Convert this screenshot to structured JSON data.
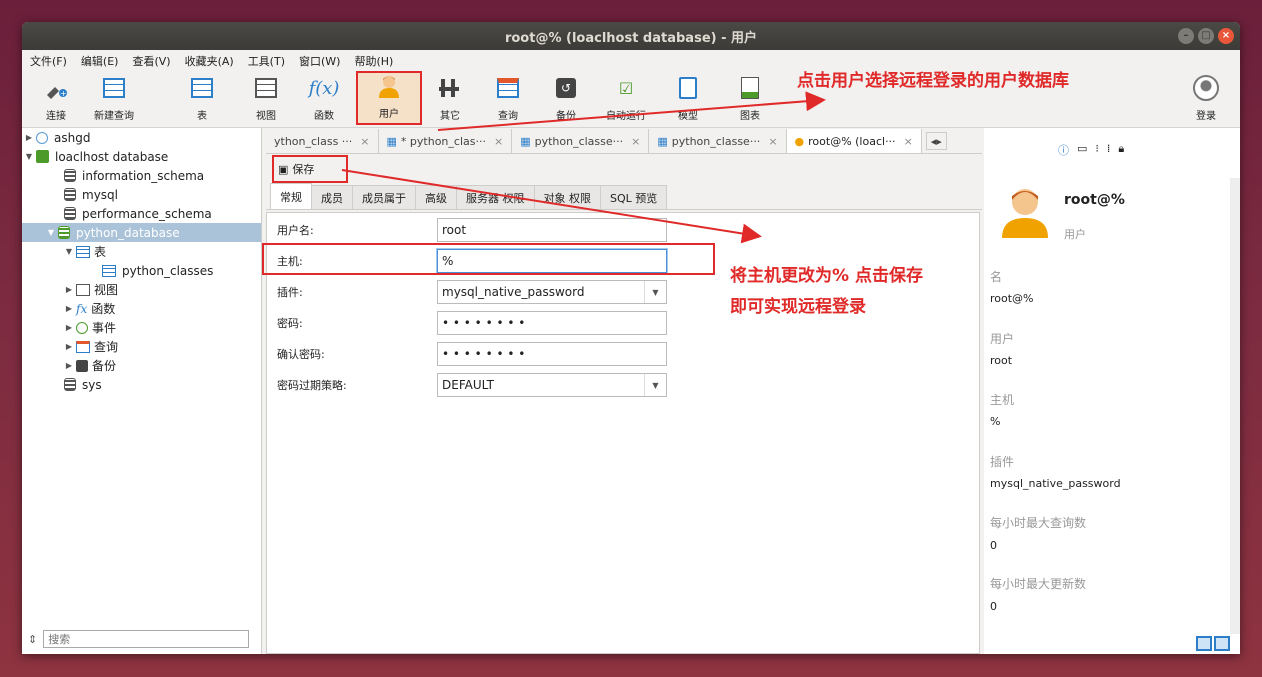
{
  "window": {
    "title": "root@% (loaclhost database) - 用户"
  },
  "menu": [
    "文件(F)",
    "编辑(E)",
    "查看(V)",
    "收藏夹(A)",
    "工具(T)",
    "窗口(W)",
    "帮助(H)"
  ],
  "toolbar": {
    "connect": "连接",
    "new_query": "新建查询",
    "table": "表",
    "view": "视图",
    "function": "函数",
    "user": "用户",
    "other": "其它",
    "query": "查询",
    "backup": "备份",
    "auto_run": "自动运行",
    "model": "模型",
    "chart": "图表",
    "login": "登录"
  },
  "tree": {
    "items": [
      {
        "label": "ashgd"
      },
      {
        "label": "loaclhost database"
      },
      {
        "label": "information_schema"
      },
      {
        "label": "mysql"
      },
      {
        "label": "performance_schema"
      },
      {
        "label": "python_database"
      },
      {
        "label": "表"
      },
      {
        "label": "python_classes"
      },
      {
        "label": "视图"
      },
      {
        "label": "函数"
      },
      {
        "label": "事件"
      },
      {
        "label": "查询"
      },
      {
        "label": "备份"
      },
      {
        "label": "sys"
      }
    ],
    "search_placeholder": "搜索"
  },
  "tabs": [
    {
      "label": "ython_class ···"
    },
    {
      "label": "* python_clas···"
    },
    {
      "label": "python_classe···"
    },
    {
      "label": "python_classe···"
    },
    {
      "label": "root@% (loacl···"
    }
  ],
  "save_label": "保存",
  "subtabs": [
    "常规",
    "成员",
    "成员属于",
    "高级",
    "服务器 权限",
    "对象 权限",
    "SQL 预览"
  ],
  "form": {
    "username_label": "用户名:",
    "username_value": "root",
    "host_label": "主机:",
    "host_value": "%",
    "plugin_label": "插件:",
    "plugin_value": "mysql_native_password",
    "password_label": "密码:",
    "password_value": "• • • • • • • •",
    "confirm_label": "确认密码:",
    "confirm_value": "• • • • • • • •",
    "expire_label": "密码过期策略:",
    "expire_value": "DEFAULT"
  },
  "info_panel": {
    "name_title": "root@%",
    "type": "用户",
    "fields": [
      {
        "label": "名",
        "value": "root@%"
      },
      {
        "label": "用户",
        "value": "root"
      },
      {
        "label": "主机",
        "value": "%"
      },
      {
        "label": "插件",
        "value": "mysql_native_password"
      },
      {
        "label": "每小时最大查询数",
        "value": "0"
      },
      {
        "label": "每小时最大更新数",
        "value": "0"
      }
    ]
  },
  "annotations": {
    "top": "点击用户选择远程登录的用户数据库",
    "mid1": "将主机更改为% 点击保存",
    "mid2": "即可实现远程登录"
  }
}
